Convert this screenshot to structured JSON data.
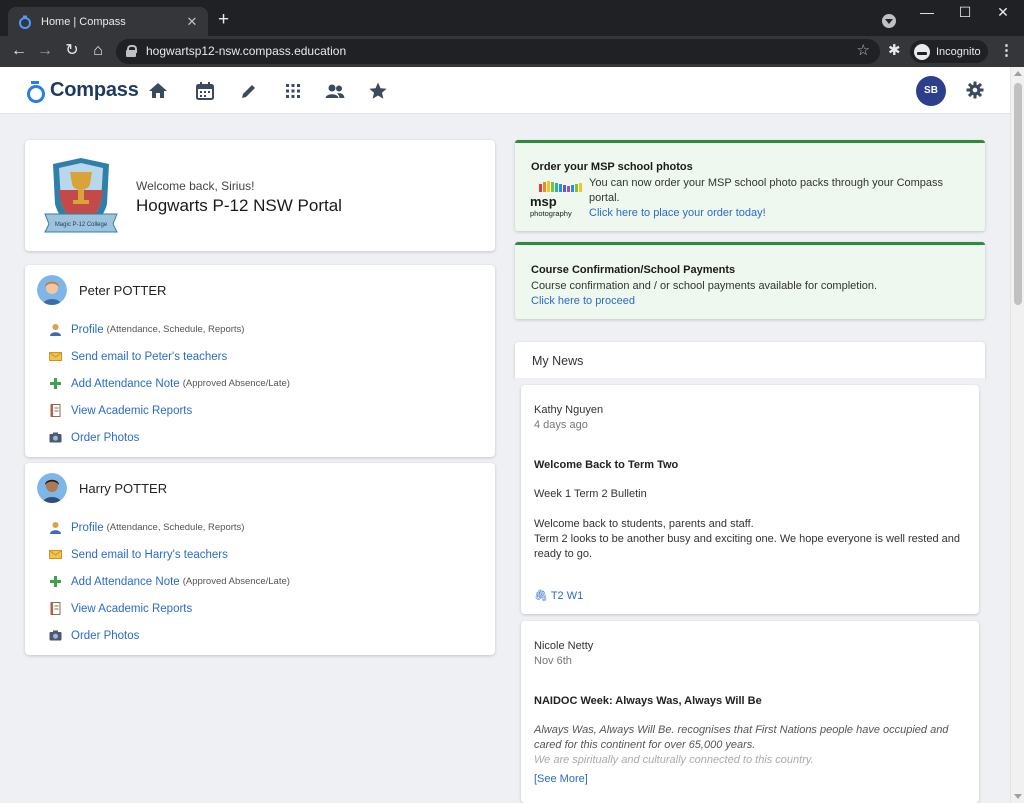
{
  "browser": {
    "tab_title": "Home | Compass",
    "url": "hogwartsp12-nsw.compass.education",
    "incognito_label": "Incognito"
  },
  "app": {
    "logo_text": "Compass",
    "user_initials": "SB"
  },
  "welcome": {
    "greeting": "Welcome back, Sirius!",
    "portal_name": "Hogwarts P-12 NSW Portal",
    "crest_label": "Magic P-12 College"
  },
  "children": [
    {
      "name": "Peter POTTER",
      "links": [
        {
          "label": "Profile",
          "note": "(Attendance, Schedule, Reports)"
        },
        {
          "label": "Send email to Peter's teachers",
          "note": ""
        },
        {
          "label": "Add Attendance Note",
          "note": "(Approved Absence/Late)"
        },
        {
          "label": "View Academic Reports",
          "note": ""
        },
        {
          "label": "Order Photos",
          "note": ""
        }
      ]
    },
    {
      "name": "Harry POTTER",
      "links": [
        {
          "label": "Profile",
          "note": "(Attendance, Schedule, Reports)"
        },
        {
          "label": "Send email to Harry's teachers",
          "note": ""
        },
        {
          "label": "Add Attendance Note",
          "note": "(Approved Absence/Late)"
        },
        {
          "label": "View Academic Reports",
          "note": ""
        },
        {
          "label": "Order Photos",
          "note": ""
        }
      ]
    }
  ],
  "promos": [
    {
      "title": "Order your MSP school photos",
      "text": "You can now order your MSP school photo packs through your Compass portal.",
      "link": "Click here to place your order today!",
      "logo_text_1": "msp",
      "logo_text_2": "photography"
    },
    {
      "title": "Course Confirmation/School Payments",
      "text": "Course confirmation and / or school payments available for completion.",
      "link": "Click here to proceed"
    }
  ],
  "news": {
    "title": "My News",
    "items": [
      {
        "author": "Kathy Nguyen",
        "date": "4 days ago",
        "headline": "Welcome Back to Term Two",
        "subhead": "Week 1 Term 2 Bulletin",
        "body_1": "Welcome back to students, parents and staff.",
        "body_2": "Term 2 looks to be another busy and exciting one. We hope everyone is well rested and ready to go.",
        "attachment": "T2 W1"
      },
      {
        "author": "Nicole Netty",
        "date": "Nov 6th",
        "headline": "NAIDOC Week: Always Was, Always Will Be",
        "body_1": "Always Was, Always Will Be. recognises that First Nations people have occupied and cared for this continent for over 65,000 years.",
        "body_2": "We are spiritually and culturally connected to this country.",
        "see_more": "[See More]"
      }
    ]
  },
  "colors": {
    "accent_blue": "#2a6bc9",
    "brand_blue": "#2a7de1",
    "promo_green": "#2e8b3e",
    "avatar_navy": "#2c3e8c"
  }
}
